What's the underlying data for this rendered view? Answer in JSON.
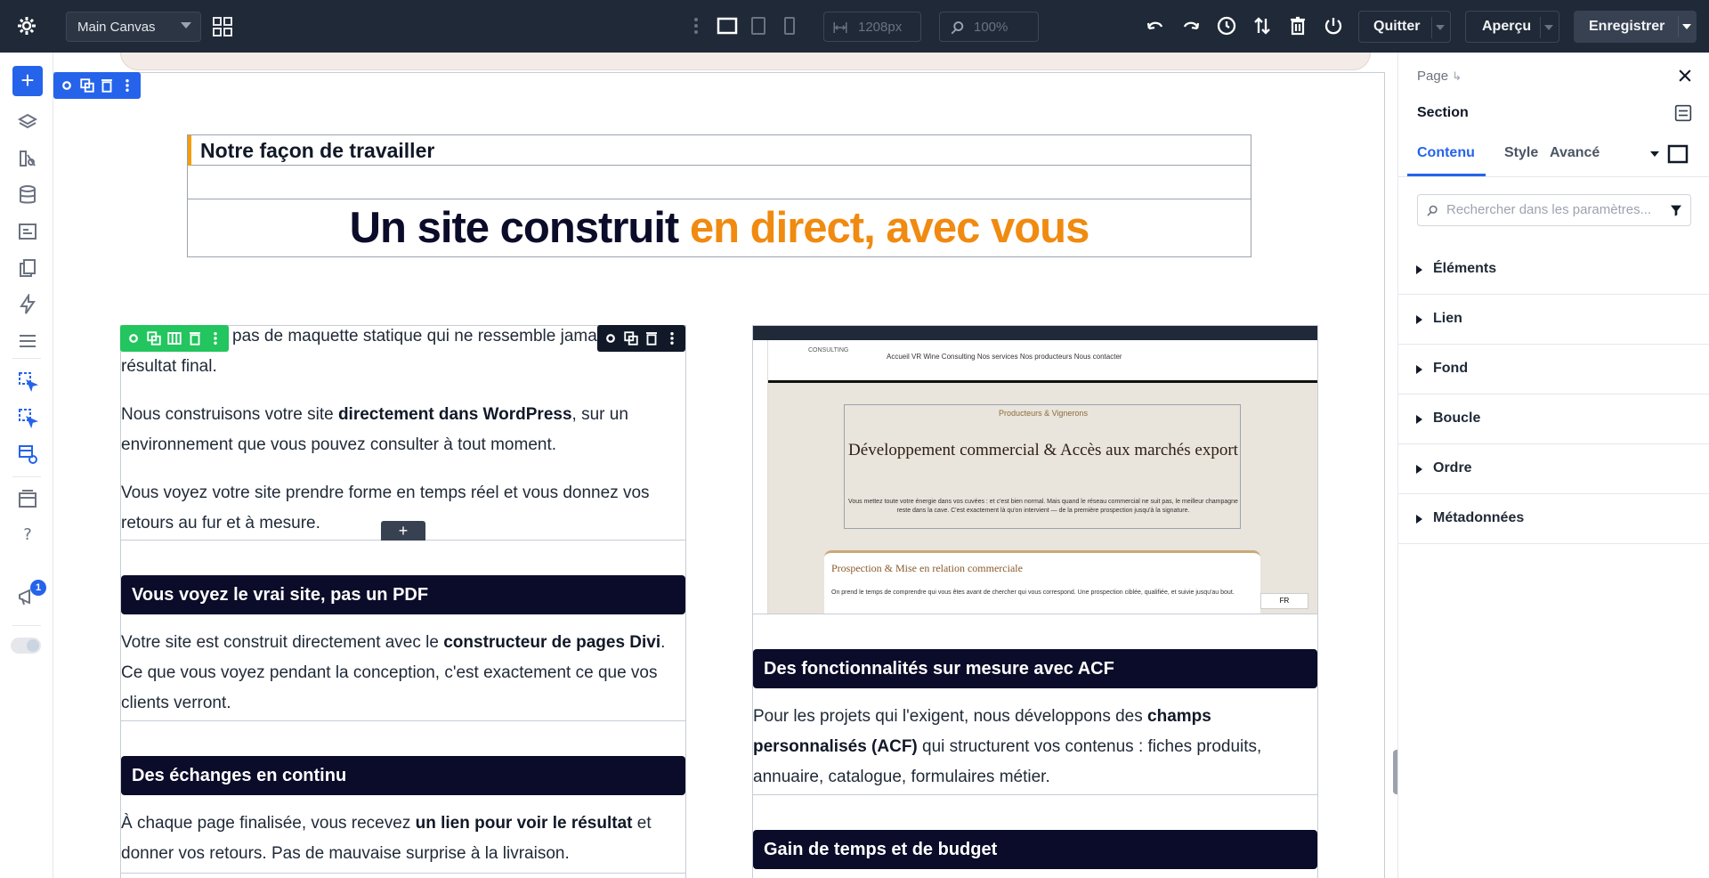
{
  "topbar": {
    "canvas_name": "Main Canvas",
    "width_value": "1208px",
    "zoom_value": "100%",
    "quit_label": "Quitter",
    "preview_label": "Aperçu",
    "save_label": "Enregistrer"
  },
  "sidebar": {
    "notification_count": "1"
  },
  "canvas": {
    "small_title": "Notre façon de travailler",
    "big_title_main": "Un site construit ",
    "big_title_accent": "en direct, avec vous",
    "left_col": {
      "intro_text": "pas de maquette statique qui ne ressemble jamais au résultat final.",
      "p1_before": "Nous construisons votre site ",
      "p1_bold": "directement dans WordPress",
      "p1_after": ", sur un environnement que vous pouvez consulter à tout moment.",
      "p2": "Vous voyez votre site prendre forme en temps réel et vous donnez vos retours au fur et à mesure.",
      "h1": "Vous voyez le vrai site, pas un PDF",
      "p3_before": "Votre site est construit directement avec le ",
      "p3_bold": "constructeur de pages Divi",
      "p3_after": ". Ce que vous voyez pendant la conception, c'est exactement ce que vos clients verront.",
      "h2": "Des échanges en continu",
      "p4_before": "À chaque page finalisée, vous recevez ",
      "p4_bold": "un lien pour voir le résultat",
      "p4_after": " et donner vos retours. Pas de mauvaise surprise à la livraison."
    },
    "right_col": {
      "shot": {
        "logo": "CONSULTING",
        "nav": "Accueil    VR Wine Consulting    Nos services    Nos producteurs    Nous contacter",
        "kicker": "Producteurs & Vignerons",
        "title": "Développement commercial & Accès aux marchés export",
        "body": "Vous mettez toute votre énergie dans vos cuvées : et c'est bien normal. Mais quand le réseau commercial ne suit pas, le meilleur champagne reste dans la cave. C'est exactement là qu'on intervient — de la première prospection jusqu'à la signature.",
        "card_title": "Prospection & Mise en relation commerciale",
        "card_body": "On prend le temps de comprendre qui vous êtes avant de chercher qui vous correspond. Une prospection ciblée, qualifiée, et suivie jusqu'au bout.",
        "lang": "FR"
      },
      "h1": "Des fonctionnalités sur mesure avec ACF",
      "p1_before": "Pour les projets qui l'exigent, nous développons des ",
      "p1_bold": "champs personnalisés (ACF)",
      "p1_after": " qui structurent vos contenus : fiches produits, annuaire, catalogue, formulaires métier.",
      "h2": "Gain de temps et de budget"
    }
  },
  "panel": {
    "breadcrumb": "Page",
    "title": "Section",
    "tabs": [
      "Contenu",
      "Style",
      "Avancé"
    ],
    "search_placeholder": "Rechercher dans les paramètres...",
    "sections": [
      "Éléments",
      "Lien",
      "Fond",
      "Boucle",
      "Ordre",
      "Métadonnées"
    ]
  },
  "colors": {
    "accent": "#f08a10",
    "primary": "#2563eb",
    "dark_heading": "#0b0b2a"
  }
}
